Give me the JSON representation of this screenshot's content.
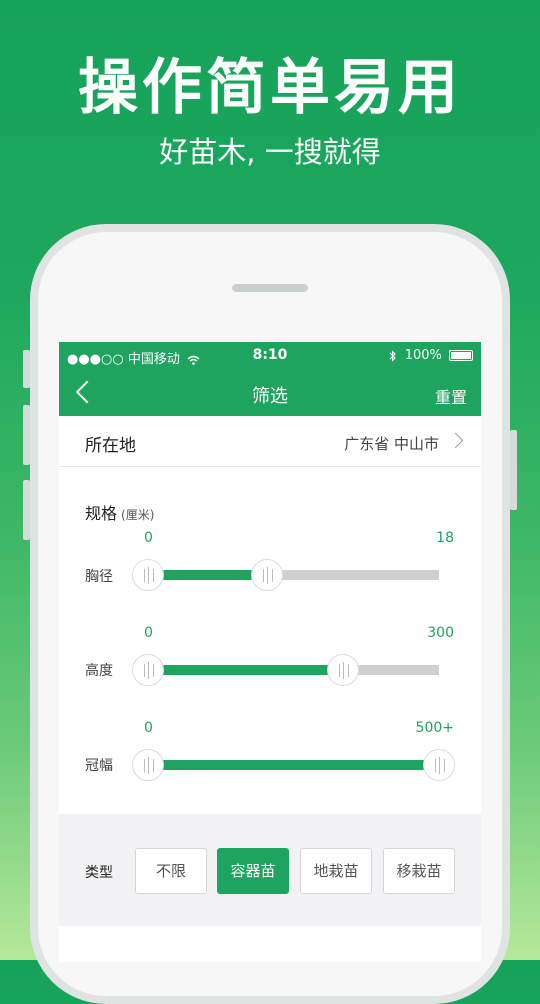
{
  "promo": {
    "headline": "操作简单易用",
    "subline": "好苗木, 一搜就得"
  },
  "status_bar": {
    "carrier": "●●●○○ 中国移动",
    "time": "8:10",
    "battery": "100%"
  },
  "nav": {
    "title": "筛选",
    "reset_label": "重置",
    "back_icon": "chevron-left-icon"
  },
  "location": {
    "label": "所在地",
    "value": "广东省 中山市"
  },
  "spec": {
    "title": "规格",
    "unit": "(厘米)",
    "sliders": [
      {
        "label": "胸径",
        "min_label": "0",
        "max_label": "18",
        "low_fraction": 0.0,
        "high_fraction": 0.41
      },
      {
        "label": "高度",
        "min_label": "0",
        "max_label": "300",
        "low_fraction": 0.0,
        "high_fraction": 0.67
      },
      {
        "label": "冠幅",
        "min_label": "0",
        "max_label": "500+",
        "low_fraction": 0.0,
        "high_fraction": 1.0
      }
    ]
  },
  "type": {
    "label": "类型",
    "options": [
      "不限",
      "容器苗",
      "地栽苗",
      "移栽苗"
    ],
    "selected": "容器苗"
  },
  "colors": {
    "brand_green": "#1fa460"
  }
}
